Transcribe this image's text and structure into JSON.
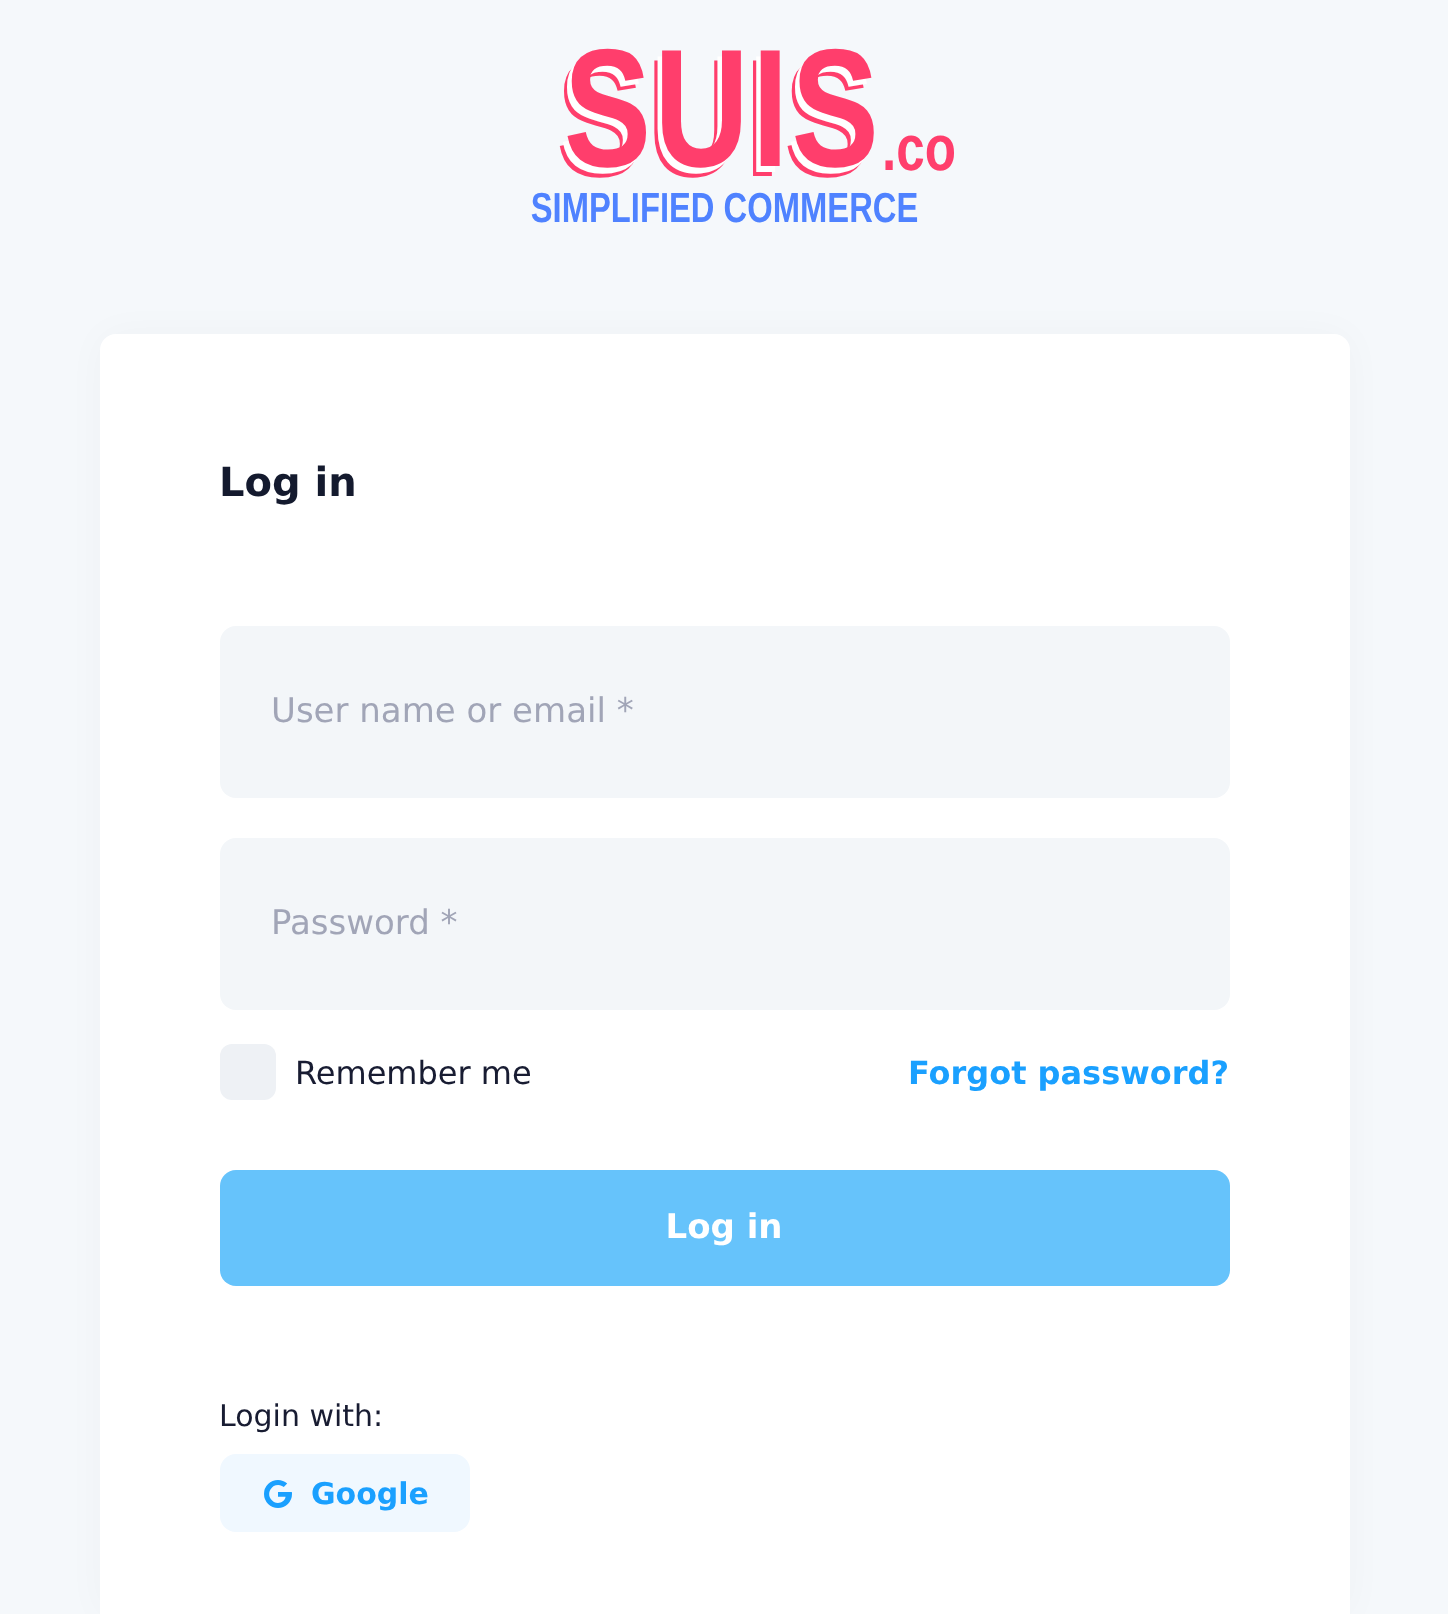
{
  "logo": {
    "name": "SUIS",
    "suffix": ".co",
    "tagline": "SIMPLIFIED COMMERCE"
  },
  "form": {
    "title": "Log in",
    "fields": [
      {
        "placeholder": "User name or email *"
      },
      {
        "placeholder": "Password *"
      }
    ],
    "remember": {
      "label": "Remember me",
      "checked": false
    },
    "forgot_link": "Forgot password?",
    "submit": "Log in",
    "social_label": "Login with:",
    "social_buttons": [
      {
        "label": "Google"
      }
    ]
  }
}
